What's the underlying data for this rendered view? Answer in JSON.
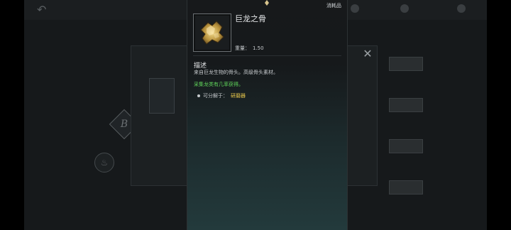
{
  "item": {
    "category": "消耗品",
    "name": "巨龙之骨",
    "weight_label": "重量：",
    "weight_value": "1.50",
    "description_title": "描述",
    "description": "来自巨龙生物的骨头。高级骨头素材。",
    "acquisition": "采集龙类有几率获得。",
    "decompose_label": "可分解于：",
    "decompose_tool": "研磨器"
  },
  "colors": {
    "acquisition_green": "#5fd35a",
    "tool_yellow": "#e9c84b"
  }
}
